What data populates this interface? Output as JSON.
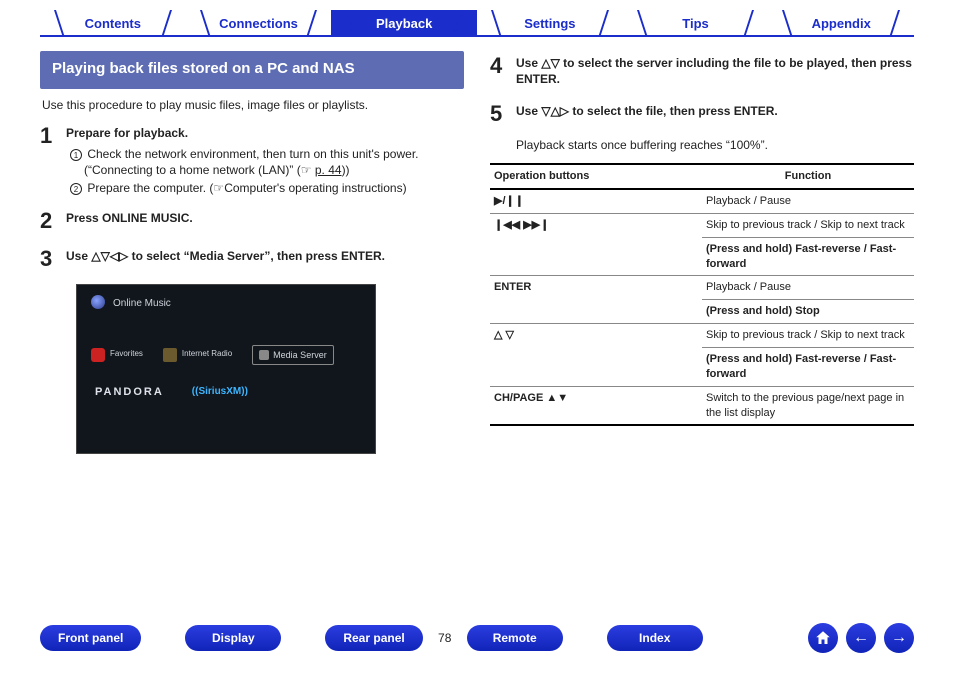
{
  "tabs": {
    "contents": "Contents",
    "connections": "Connections",
    "playback": "Playback",
    "settings": "Settings",
    "tips": "Tips",
    "appendix": "Appendix"
  },
  "heading": "Playing back files stored on a PC and NAS",
  "intro": "Use this procedure to play music files, image files or playlists.",
  "steps": {
    "s1": {
      "n": "1",
      "title": "Prepare for playback.",
      "a": "Check the network environment, then turn on this unit's power. (“Connecting to a home network (LAN)” (",
      "a_link": "p. 44",
      "a_tail": "))",
      "b": "Prepare the computer. (",
      "b_tail": "Computer's operating instructions)"
    },
    "s2": {
      "n": "2",
      "title": "Press ONLINE MUSIC."
    },
    "s3": {
      "n": "3",
      "title": "Use △▽◁▷ to select “Media Server”, then press ENTER."
    },
    "s4": {
      "n": "4",
      "title": "Use △▽ to select the server including the file to be played, then press ENTER."
    },
    "s5": {
      "n": "5",
      "title": "Use ▽△▷ to select the file, then press ENTER.",
      "sub": "Playback starts once buffering reaches “100%”."
    }
  },
  "screenshot": {
    "title": "Online Music",
    "fav": "Favorites",
    "ir": "Internet Radio",
    "ms": "Media Server",
    "pandora": "PANDORA",
    "sxm": "((SiriusXM))"
  },
  "func_table": {
    "h1": "Operation buttons",
    "h2": "Function",
    "rows": [
      {
        "op": "▶/❙❙",
        "fn": "Playback / Pause"
      },
      {
        "op": "❙◀◀ ▶▶❙",
        "fn1": "Skip to previous track / Skip to next track",
        "fn2": "(Press and hold) Fast-reverse / Fast-forward"
      },
      {
        "op": "ENTER",
        "fn1": "Playback / Pause",
        "fn2": "(Press and hold) Stop"
      },
      {
        "op": "△ ▽",
        "fn1": "Skip to previous track / Skip to next track",
        "fn2": "(Press and hold) Fast-reverse / Fast-forward"
      },
      {
        "op": "CH/PAGE ▲▼",
        "fn": "Switch to the previous page/next page in the list display"
      }
    ]
  },
  "bottom": {
    "front": "Front panel",
    "display": "Display",
    "rear": "Rear panel",
    "page": "78",
    "remote": "Remote",
    "index": "Index"
  }
}
